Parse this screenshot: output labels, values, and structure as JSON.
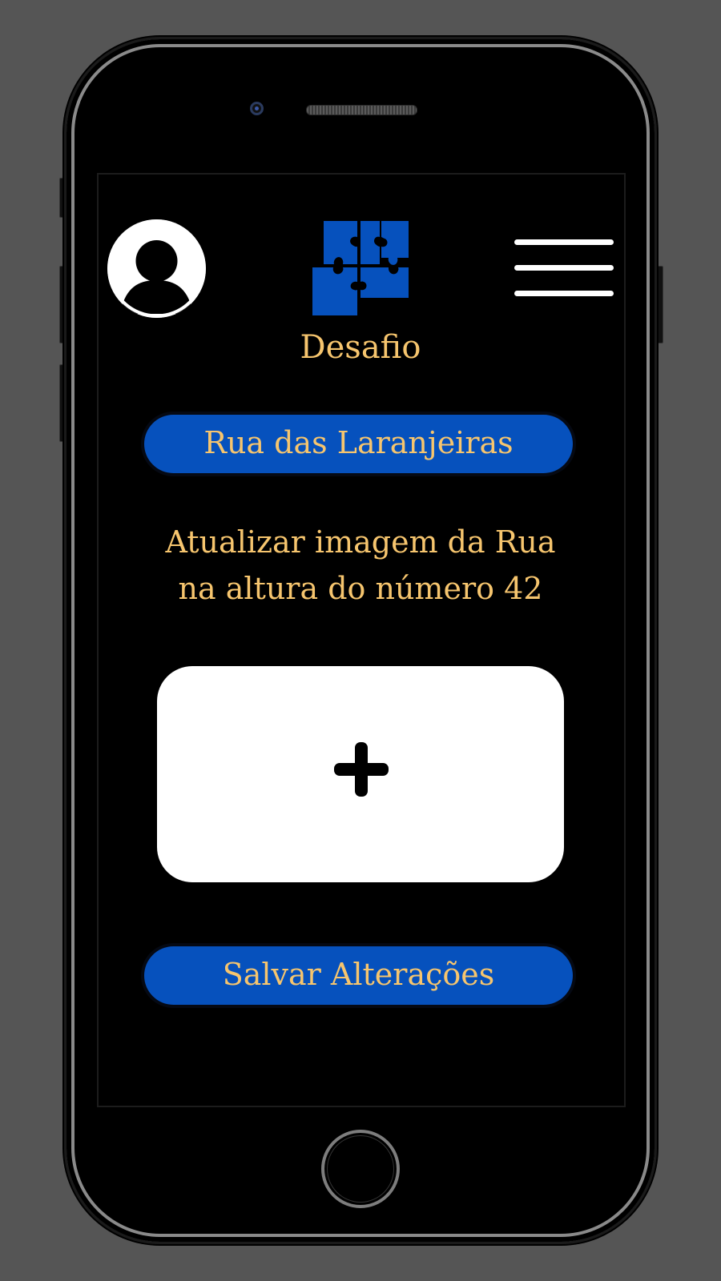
{
  "header": {
    "app_title": "Desafio",
    "avatar_icon": "user-avatar-icon",
    "logo_icon": "puzzle-icon",
    "menu_icon": "hamburger-menu-icon"
  },
  "main": {
    "street_name": "Rua das Laranjeiras",
    "instruction_line1": "Atualizar imagem da Rua",
    "instruction_line2": "na altura do número 42",
    "upload_icon": "plus-icon",
    "save_label": "Salvar Alterações"
  },
  "colors": {
    "background": "#555555",
    "accent_blue": "#0651bd",
    "text_gold": "#f6c56e",
    "screen": "#000000"
  }
}
